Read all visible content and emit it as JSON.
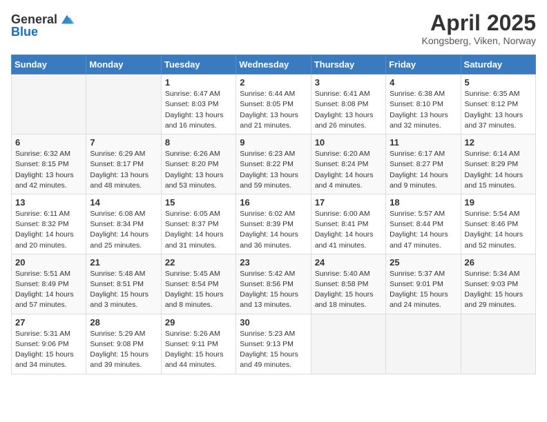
{
  "header": {
    "logo_general": "General",
    "logo_blue": "Blue",
    "title": "April 2025",
    "location": "Kongsberg, Viken, Norway"
  },
  "calendar": {
    "days_of_week": [
      "Sunday",
      "Monday",
      "Tuesday",
      "Wednesday",
      "Thursday",
      "Friday",
      "Saturday"
    ],
    "weeks": [
      [
        {
          "day": "",
          "info": ""
        },
        {
          "day": "",
          "info": ""
        },
        {
          "day": "1",
          "info": "Sunrise: 6:47 AM\nSunset: 8:03 PM\nDaylight: 13 hours and 16 minutes."
        },
        {
          "day": "2",
          "info": "Sunrise: 6:44 AM\nSunset: 8:05 PM\nDaylight: 13 hours and 21 minutes."
        },
        {
          "day": "3",
          "info": "Sunrise: 6:41 AM\nSunset: 8:08 PM\nDaylight: 13 hours and 26 minutes."
        },
        {
          "day": "4",
          "info": "Sunrise: 6:38 AM\nSunset: 8:10 PM\nDaylight: 13 hours and 32 minutes."
        },
        {
          "day": "5",
          "info": "Sunrise: 6:35 AM\nSunset: 8:12 PM\nDaylight: 13 hours and 37 minutes."
        }
      ],
      [
        {
          "day": "6",
          "info": "Sunrise: 6:32 AM\nSunset: 8:15 PM\nDaylight: 13 hours and 42 minutes."
        },
        {
          "day": "7",
          "info": "Sunrise: 6:29 AM\nSunset: 8:17 PM\nDaylight: 13 hours and 48 minutes."
        },
        {
          "day": "8",
          "info": "Sunrise: 6:26 AM\nSunset: 8:20 PM\nDaylight: 13 hours and 53 minutes."
        },
        {
          "day": "9",
          "info": "Sunrise: 6:23 AM\nSunset: 8:22 PM\nDaylight: 13 hours and 59 minutes."
        },
        {
          "day": "10",
          "info": "Sunrise: 6:20 AM\nSunset: 8:24 PM\nDaylight: 14 hours and 4 minutes."
        },
        {
          "day": "11",
          "info": "Sunrise: 6:17 AM\nSunset: 8:27 PM\nDaylight: 14 hours and 9 minutes."
        },
        {
          "day": "12",
          "info": "Sunrise: 6:14 AM\nSunset: 8:29 PM\nDaylight: 14 hours and 15 minutes."
        }
      ],
      [
        {
          "day": "13",
          "info": "Sunrise: 6:11 AM\nSunset: 8:32 PM\nDaylight: 14 hours and 20 minutes."
        },
        {
          "day": "14",
          "info": "Sunrise: 6:08 AM\nSunset: 8:34 PM\nDaylight: 14 hours and 25 minutes."
        },
        {
          "day": "15",
          "info": "Sunrise: 6:05 AM\nSunset: 8:37 PM\nDaylight: 14 hours and 31 minutes."
        },
        {
          "day": "16",
          "info": "Sunrise: 6:02 AM\nSunset: 8:39 PM\nDaylight: 14 hours and 36 minutes."
        },
        {
          "day": "17",
          "info": "Sunrise: 6:00 AM\nSunset: 8:41 PM\nDaylight: 14 hours and 41 minutes."
        },
        {
          "day": "18",
          "info": "Sunrise: 5:57 AM\nSunset: 8:44 PM\nDaylight: 14 hours and 47 minutes."
        },
        {
          "day": "19",
          "info": "Sunrise: 5:54 AM\nSunset: 8:46 PM\nDaylight: 14 hours and 52 minutes."
        }
      ],
      [
        {
          "day": "20",
          "info": "Sunrise: 5:51 AM\nSunset: 8:49 PM\nDaylight: 14 hours and 57 minutes."
        },
        {
          "day": "21",
          "info": "Sunrise: 5:48 AM\nSunset: 8:51 PM\nDaylight: 15 hours and 3 minutes."
        },
        {
          "day": "22",
          "info": "Sunrise: 5:45 AM\nSunset: 8:54 PM\nDaylight: 15 hours and 8 minutes."
        },
        {
          "day": "23",
          "info": "Sunrise: 5:42 AM\nSunset: 8:56 PM\nDaylight: 15 hours and 13 minutes."
        },
        {
          "day": "24",
          "info": "Sunrise: 5:40 AM\nSunset: 8:58 PM\nDaylight: 15 hours and 18 minutes."
        },
        {
          "day": "25",
          "info": "Sunrise: 5:37 AM\nSunset: 9:01 PM\nDaylight: 15 hours and 24 minutes."
        },
        {
          "day": "26",
          "info": "Sunrise: 5:34 AM\nSunset: 9:03 PM\nDaylight: 15 hours and 29 minutes."
        }
      ],
      [
        {
          "day": "27",
          "info": "Sunrise: 5:31 AM\nSunset: 9:06 PM\nDaylight: 15 hours and 34 minutes."
        },
        {
          "day": "28",
          "info": "Sunrise: 5:29 AM\nSunset: 9:08 PM\nDaylight: 15 hours and 39 minutes."
        },
        {
          "day": "29",
          "info": "Sunrise: 5:26 AM\nSunset: 9:11 PM\nDaylight: 15 hours and 44 minutes."
        },
        {
          "day": "30",
          "info": "Sunrise: 5:23 AM\nSunset: 9:13 PM\nDaylight: 15 hours and 49 minutes."
        },
        {
          "day": "",
          "info": ""
        },
        {
          "day": "",
          "info": ""
        },
        {
          "day": "",
          "info": ""
        }
      ]
    ]
  }
}
